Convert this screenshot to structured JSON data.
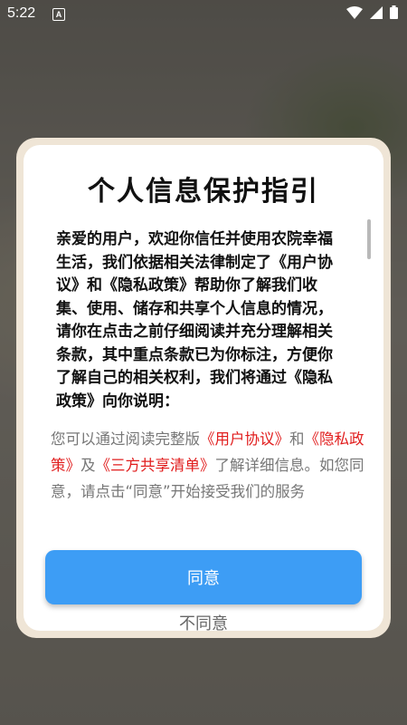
{
  "status_bar": {
    "time": "5:22",
    "notification_icon": "a-icon",
    "wifi_icon": "wifi-icon",
    "signal_icon": "signal-icon",
    "battery_icon": "battery-icon"
  },
  "dialog": {
    "title": "个人信息保护指引",
    "body_text": "亲爱的用户，欢迎你信任并使用农院幸福生活，我们依据相关法律制定了《用户协议》和《隐私政策》帮助你了解我们收集、使用、储存和共享个人信息的情况，请你在点击之前仔细阅读并充分理解相关条款，其中重点条款已为你标注，方便你了解自己的相关权利，我们将通过《隐私政策》向你说明：",
    "info": {
      "prefix": "您可以通过阅读完整版",
      "link_user_agreement": "《用户协议》",
      "and": "和",
      "link_privacy_policy": "《隐私政策》",
      "also": "及",
      "link_third_party": "《三方共享清单》",
      "suffix": "了解详细信息。如您同意，请点击“同意”开始接受我们的服务"
    },
    "agree_label": "同意",
    "disagree_label": "不同意"
  },
  "colors": {
    "accent": "#3d9df5",
    "link": "#e11d1d"
  }
}
